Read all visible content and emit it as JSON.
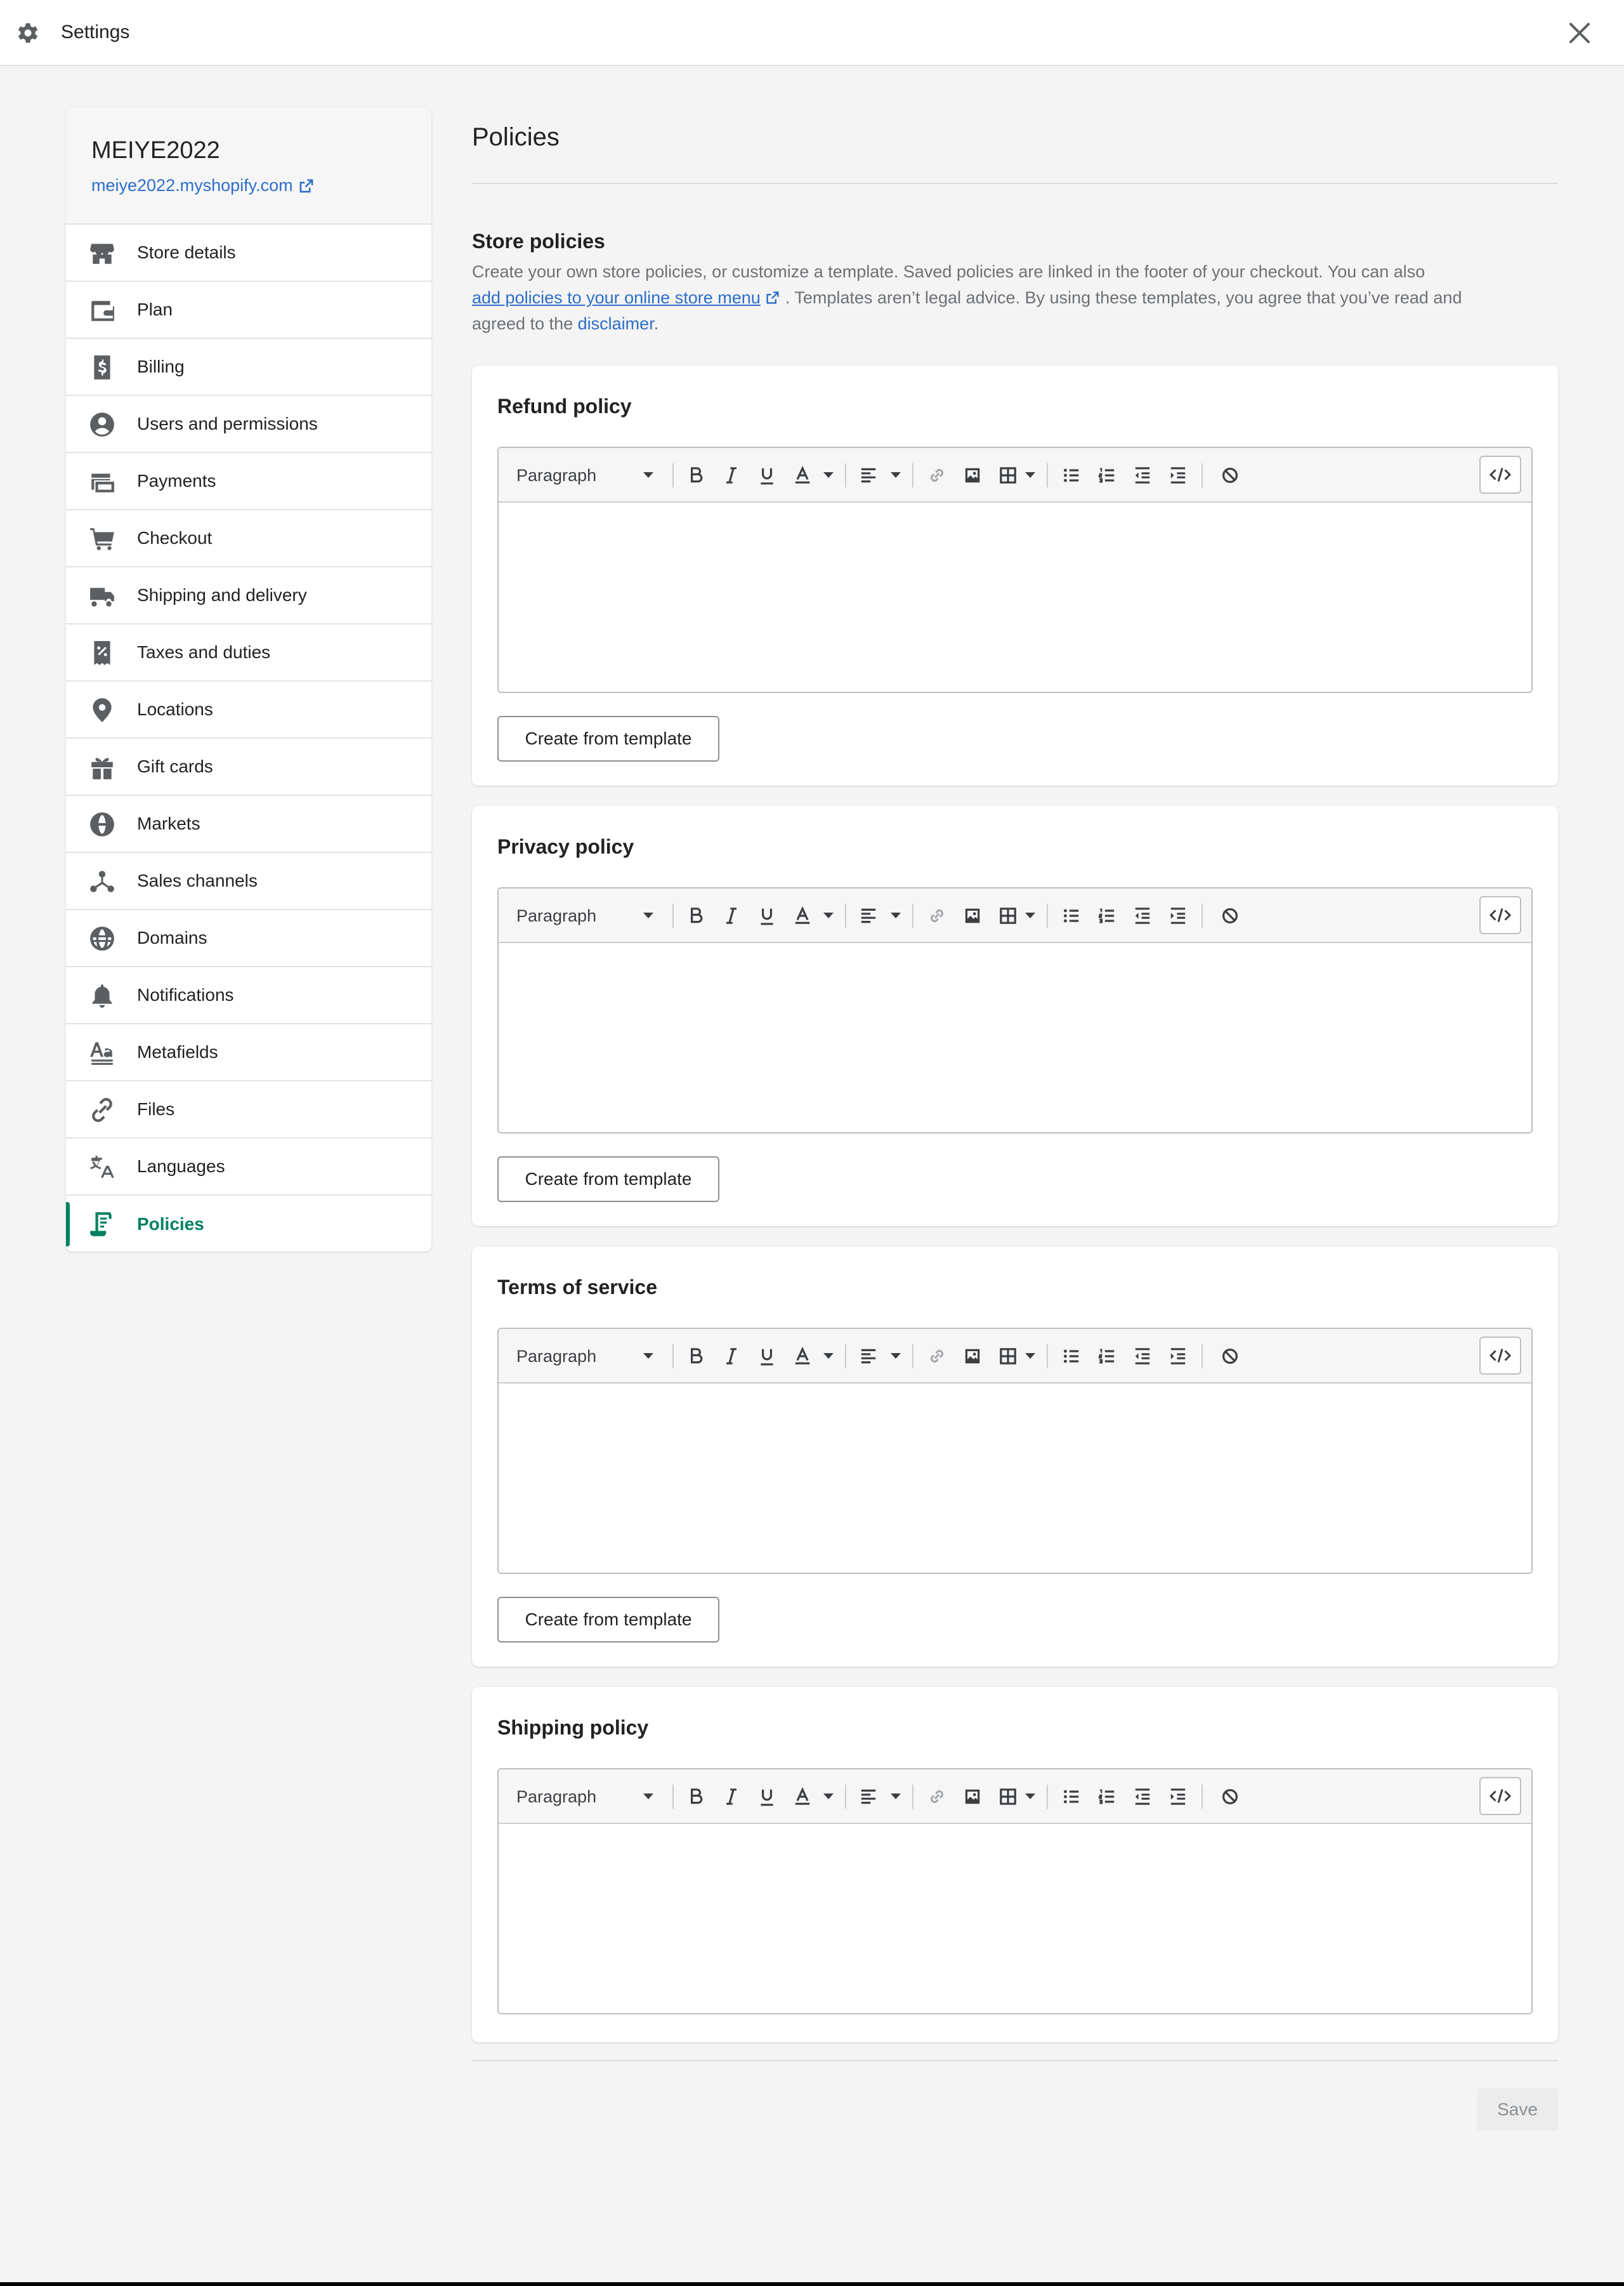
{
  "topbar": {
    "title": "Settings"
  },
  "sidebar": {
    "store_name": "MEIYE2022",
    "store_url": "meiye2022.myshopify.com",
    "items": [
      {
        "label": "Store details",
        "icon": "store-icon"
      },
      {
        "label": "Plan",
        "icon": "wallet-icon"
      },
      {
        "label": "Billing",
        "icon": "billing-icon"
      },
      {
        "label": "Users and permissions",
        "icon": "user-icon"
      },
      {
        "label": "Payments",
        "icon": "payments-icon"
      },
      {
        "label": "Checkout",
        "icon": "cart-icon"
      },
      {
        "label": "Shipping and delivery",
        "icon": "truck-icon"
      },
      {
        "label": "Taxes and duties",
        "icon": "tax-receipt-icon"
      },
      {
        "label": "Locations",
        "icon": "location-pin-icon"
      },
      {
        "label": "Gift cards",
        "icon": "gift-icon"
      },
      {
        "label": "Markets",
        "icon": "globe-markets-icon"
      },
      {
        "label": "Sales channels",
        "icon": "channels-icon"
      },
      {
        "label": "Domains",
        "icon": "domain-globe-icon"
      },
      {
        "label": "Notifications",
        "icon": "bell-icon"
      },
      {
        "label": "Metafields",
        "icon": "metafields-icon"
      },
      {
        "label": "Files",
        "icon": "paperclip-icon"
      },
      {
        "label": "Languages",
        "icon": "translate-icon"
      },
      {
        "label": "Policies",
        "icon": "policy-icon",
        "active": true
      }
    ]
  },
  "main": {
    "title": "Policies",
    "section_title": "Store policies",
    "desc_1": "Create your own store policies, or customize a template. Saved policies are linked in the footer of your checkout. You can also",
    "desc_link": "add policies to your online store menu",
    "desc_2": ". Templates aren’t legal advice. By using these templates, you agree that you’ve read and agreed to the",
    "desc_disclaimer": "disclaimer",
    "desc_end": ".",
    "toolbar_format": "Paragraph",
    "template_button": "Create from template",
    "policies": [
      {
        "title": "Refund policy",
        "content": ""
      },
      {
        "title": "Privacy policy",
        "content": ""
      },
      {
        "title": "Terms of service",
        "content": ""
      },
      {
        "title": "Shipping policy",
        "content": ""
      }
    ],
    "save_label": "Save"
  },
  "colors": {
    "accent": "#008060",
    "link": "#2c6ecb",
    "text": "#202223",
    "subdued": "#6d7175",
    "background": "#f4f4f4"
  }
}
